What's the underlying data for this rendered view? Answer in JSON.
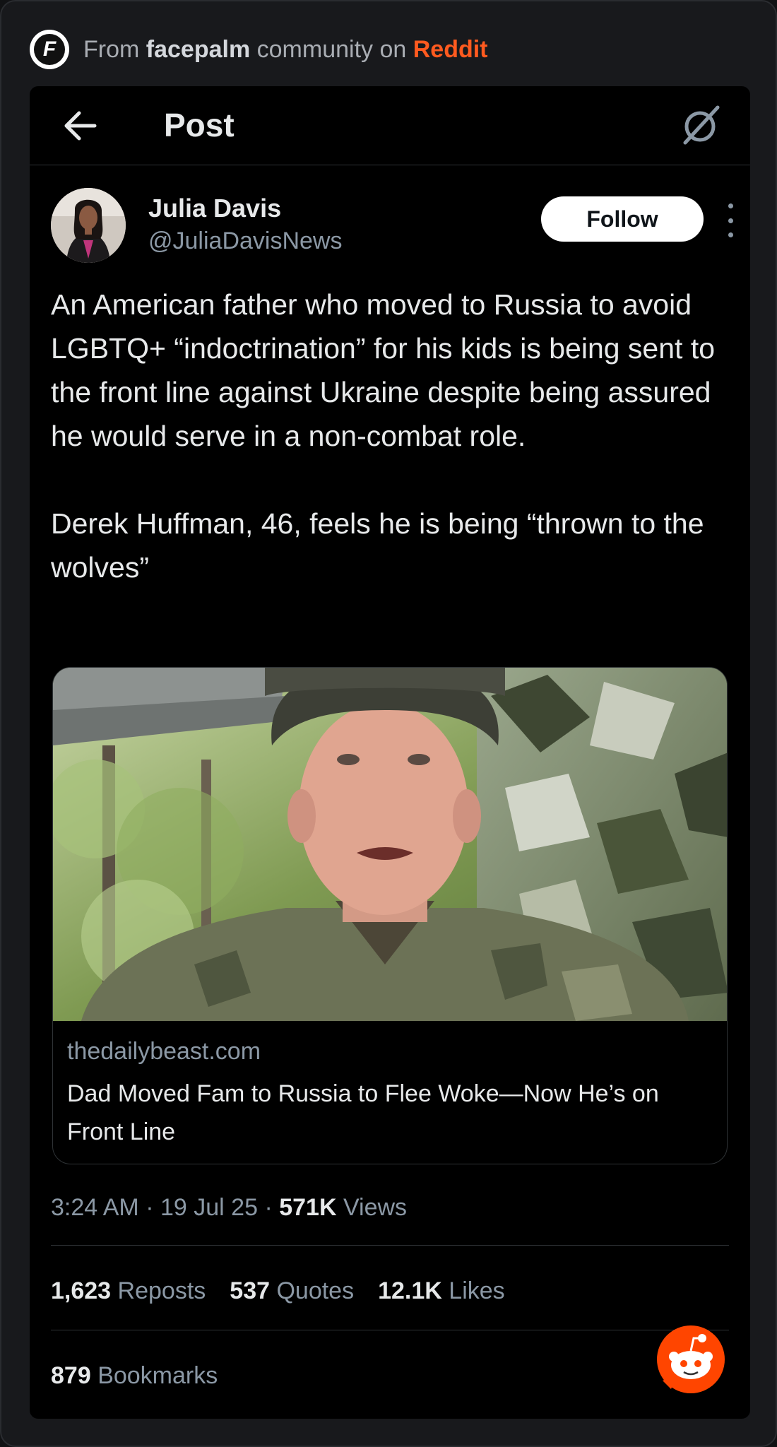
{
  "source": {
    "prefix": "From",
    "community": "facepalm",
    "middle": "community on",
    "platform": "Reddit",
    "logo_letter": "F"
  },
  "topbar": {
    "title": "Post"
  },
  "author": {
    "name": "Julia Davis",
    "handle": "@JuliaDavisNews",
    "follow_label": "Follow"
  },
  "post": {
    "paragraph1": "An American father who moved to Russia to avoid LGBTQ+ “indoctrination” for his kids is being sent to the front line against Ukraine despite being assured he would serve in a non-combat role.",
    "paragraph2": "Derek Huffman, 46, feels he is being “thrown to the wolves”"
  },
  "link_card": {
    "domain": "thedailybeast.com",
    "headline": "Dad Moved Fam to Russia to Flee Woke—Now He’s on Front Line"
  },
  "meta": {
    "time": "3:24 AM",
    "date": "19 Jul 25",
    "views_count": "571K",
    "views_label": "Views"
  },
  "stats": {
    "reposts_count": "1,623",
    "reposts_label": "Reposts",
    "quotes_count": "537",
    "quotes_label": "Quotes",
    "likes_count": "12.1K",
    "likes_label": "Likes",
    "bookmarks_count": "879",
    "bookmarks_label": "Bookmarks"
  },
  "colors": {
    "background": "#000000",
    "reddit_orange": "#ff5a1f",
    "muted_text": "#8b98a5",
    "primary_text": "#e7e9ea"
  },
  "icons": [
    "back-arrow-icon",
    "grok-icon",
    "more-options-icon",
    "reddit-snoo-icon",
    "facepalm-logo-icon"
  ]
}
